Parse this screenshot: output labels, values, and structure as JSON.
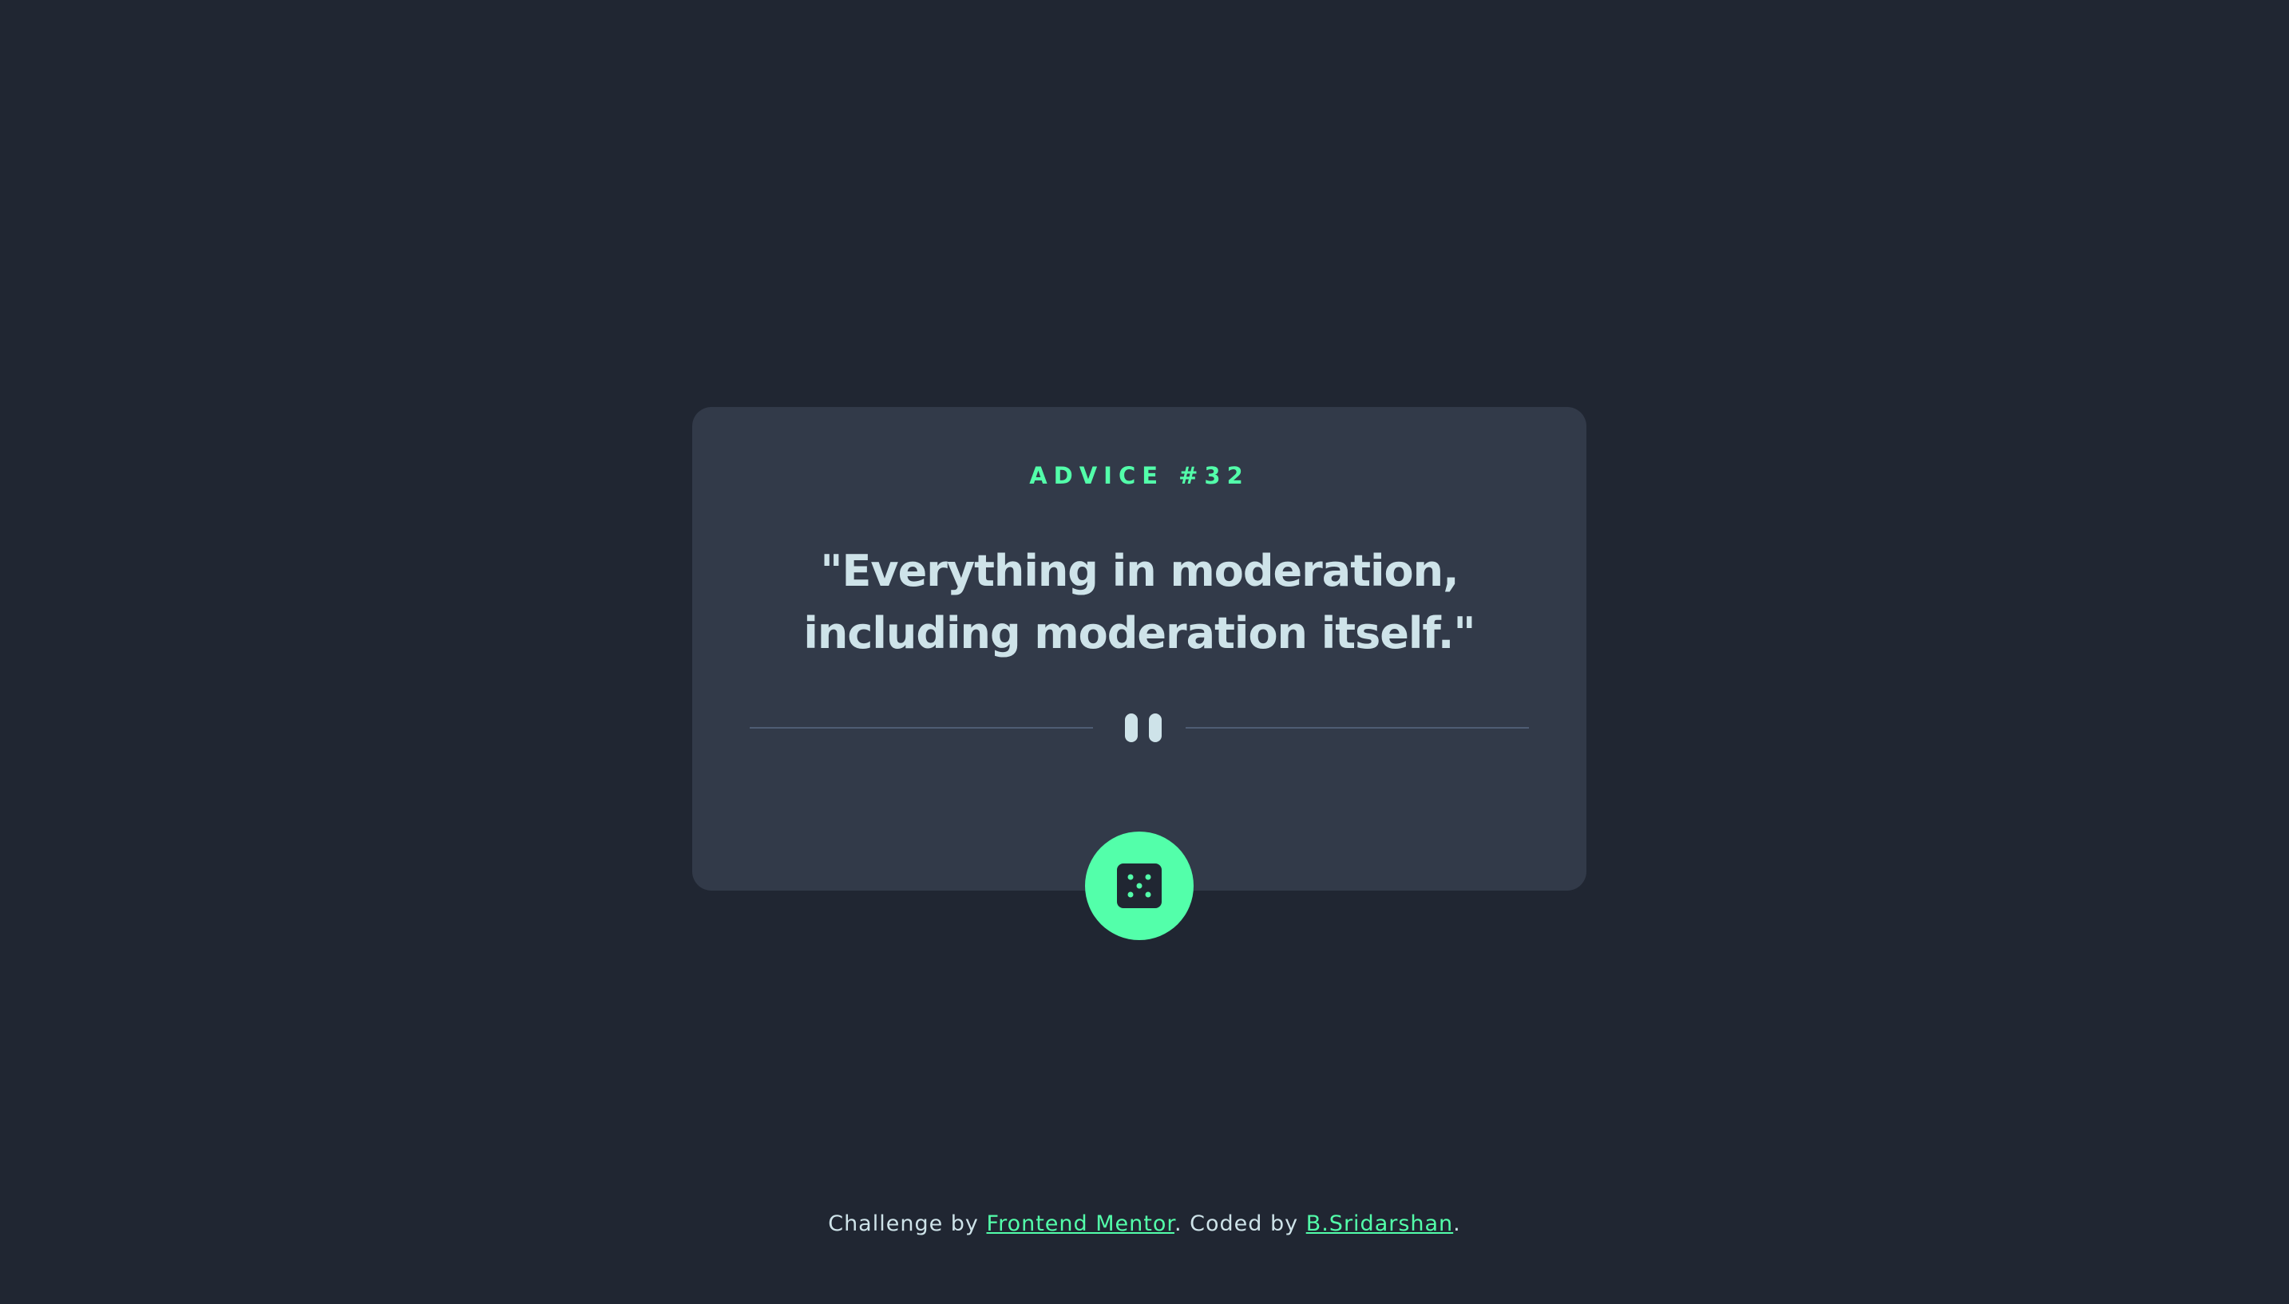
{
  "card": {
    "advice_label": "ADVICE #32",
    "advice_text": "\"Everything in moderation, including moderation itself.\""
  },
  "icons": {
    "divider": "pause-icon",
    "button": "dice-icon"
  },
  "footer": {
    "prefix": "Challenge by ",
    "challenge_link": "Frontend Mentor",
    "middle": ". Coded by ",
    "author_link": "B.Sridarshan",
    "suffix": "."
  },
  "colors": {
    "background": "#202632",
    "card": "#323a49",
    "accent": "#53ffaa",
    "text": "#cee3e9",
    "divider": "#4f5d74"
  }
}
